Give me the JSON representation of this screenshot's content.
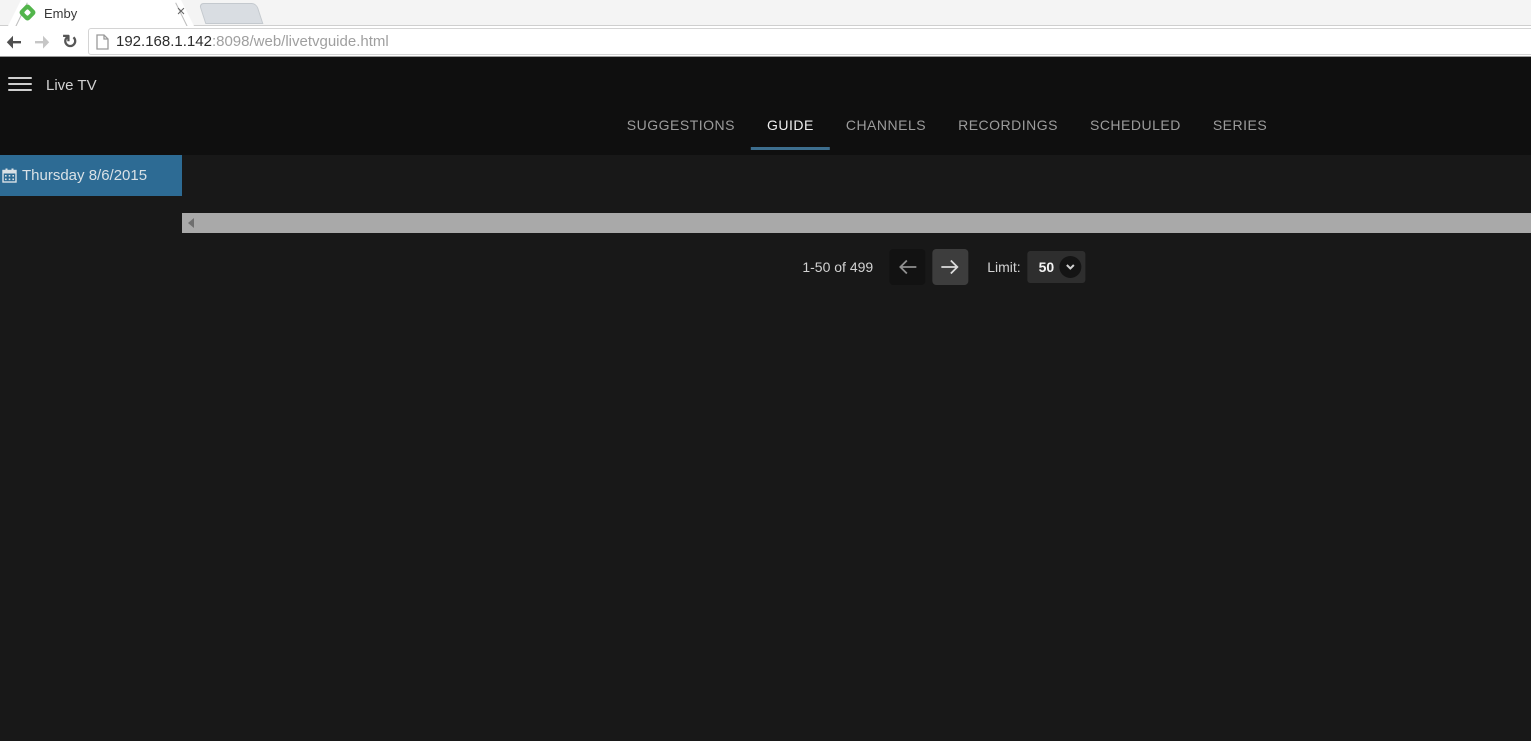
{
  "browser": {
    "tab": {
      "title": "Emby"
    },
    "url": {
      "host": "192.168.1.142",
      "path": ":8098/web/livetvguide.html"
    }
  },
  "app": {
    "title": "Live TV",
    "tabs": [
      {
        "label": "SUGGESTIONS",
        "active": false
      },
      {
        "label": "GUIDE",
        "active": true
      },
      {
        "label": "CHANNELS",
        "active": false
      },
      {
        "label": "RECORDINGS",
        "active": false
      },
      {
        "label": "SCHEDULED",
        "active": false
      },
      {
        "label": "SERIES",
        "active": false
      }
    ],
    "date_button": {
      "label": "Thursday 8/6/2015"
    },
    "pagination": {
      "range": "1-50 of 499",
      "limit_label": "Limit:",
      "limit_value": "50",
      "limit_options": [
        "50"
      ]
    }
  },
  "icons": {
    "close": "×",
    "reload": "↻",
    "menu": "hamburger",
    "favicon": "emby-green-diamond",
    "back": "arrow-left",
    "forward": "arrow-right",
    "page": "document-outline",
    "calendar": "calendar-grid",
    "prev_page": "arrow-left",
    "next_page": "arrow-right",
    "chevron": "chevron-down",
    "scroll_left": "triangle-left"
  },
  "colors": {
    "accent_green": "#52b54b",
    "tab_underline": "#3d6e8e",
    "date_button_bg": "#2d6b94",
    "header_bg": "#0f0f0f",
    "content_bg": "#181818",
    "scrollbar": "#a9a9a9"
  }
}
